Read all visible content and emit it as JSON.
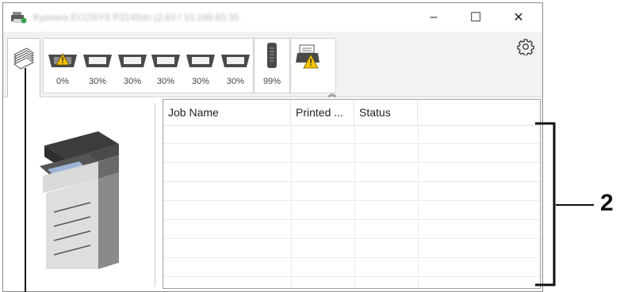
{
  "window": {
    "title": "Kyocera ECOSYS P3145dn (2.83 / 10.186.63.35",
    "controls": {
      "minimize": "–",
      "maximize": "☐",
      "close": "✕"
    }
  },
  "toolbar": {
    "trays": [
      {
        "name": "tray-1",
        "level": "0%",
        "warning": true
      },
      {
        "name": "tray-2",
        "level": "30%",
        "warning": false
      },
      {
        "name": "tray-3",
        "level": "30%",
        "warning": false
      },
      {
        "name": "tray-4",
        "level": "30%",
        "warning": false
      },
      {
        "name": "tray-5",
        "level": "30%",
        "warning": false
      },
      {
        "name": "tray-6",
        "level": "30%",
        "warning": false
      }
    ],
    "toner": {
      "level": "99%"
    },
    "collapse_glyph": "︽",
    "icons": {
      "jobs_tab": "stacked-pages-icon",
      "settings": "gear-icon",
      "paper_warning": "paper-warning-icon"
    }
  },
  "job_table": {
    "columns": [
      "Job Name",
      "Printed ...",
      "Status",
      ""
    ],
    "rows": []
  },
  "annotation": {
    "callout_number": "2"
  },
  "colors": {
    "warning": "#f5c400",
    "tray_dark": "#4a4a4a"
  }
}
